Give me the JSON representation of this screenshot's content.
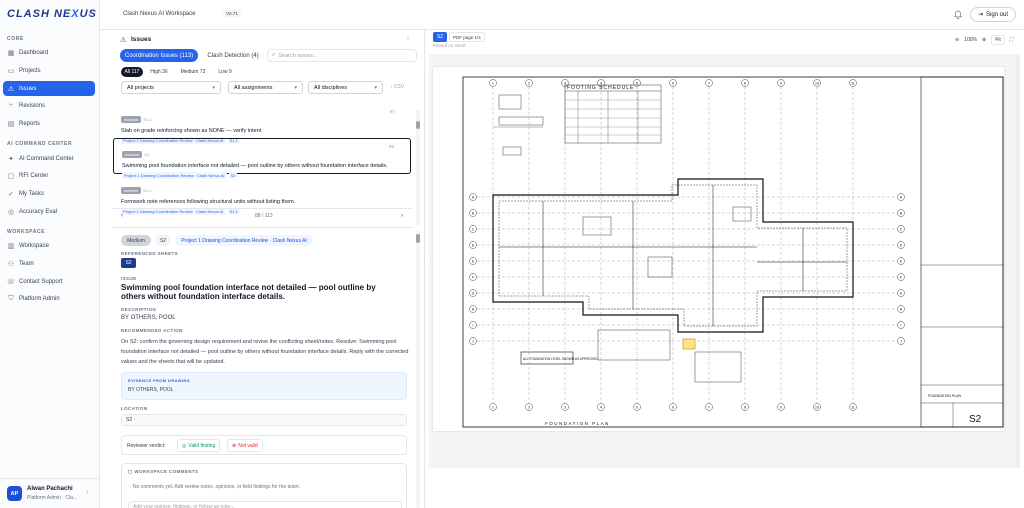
{
  "app": {
    "logo_left": "CLASH NE",
    "logo_accent": "X",
    "logo_right": "US",
    "workspace_name": "Clash Nexus AI Workspace",
    "version": "V0.71"
  },
  "topbar": {
    "signout_label": "Sign out"
  },
  "sidebar": {
    "sections": [
      {
        "title": "CORE",
        "items": [
          "Dashboard",
          "Projects",
          "Issues",
          "Revisions",
          "Reports"
        ]
      },
      {
        "title": "AI COMMAND CENTER",
        "items": [
          "AI Command Center",
          "RFI Center",
          "My Tasks",
          "Accuracy Eval"
        ]
      },
      {
        "title": "WORKSPACE",
        "items": [
          "Workspace",
          "Team",
          "Contact Support",
          "Platform Admin"
        ]
      }
    ],
    "active_item": "Issues"
  },
  "user": {
    "initials": "AP",
    "name": "Alwan Pachachi",
    "role": "Platform Admin · Cla..."
  },
  "issues": {
    "title": "Issues",
    "tabs": [
      "Coordination Issues (113)",
      "Clash Detection (4)"
    ],
    "search_placeholder": "Search issues...",
    "filter_chips": [
      "All 117",
      "High 36",
      "Medium 73",
      "Low 9"
    ],
    "selects": [
      "All projects",
      "All assignments",
      "All disciplines"
    ],
    "csv_label": "CSV",
    "list": [
      {
        "status": "medium",
        "id": "S1-1",
        "num": "87",
        "text": "Slab on grade reinforcing shown as NONE — verify intent",
        "tags": [
          "Project 1 Drawing Coordination Review · Clash Nexus AI",
          "S1.1"
        ]
      },
      {
        "status": "medium",
        "id": "S2",
        "num": "88",
        "text": "Swimming pool foundation interface not detailed — pool outline by others without foundation interface details.",
        "tags": [
          "Project 1 Drawing Coordination Review · Clash Nexus AI",
          "S2"
        ]
      },
      {
        "status": "medium",
        "id": "S1-1",
        "num": "",
        "text": "Formwork note references following structural units without listing them.",
        "tags": [
          "Project 1 Drawing Coordination Review · Clash Nexus AI",
          "S1.1"
        ]
      }
    ],
    "pager": "88 / 113"
  },
  "detail": {
    "chips": [
      "Medium",
      "S2",
      "Project 1 Drawing Coordination Review · Clash Nexus AI"
    ],
    "ref_sheets_label": "REFERENCED SHEETS",
    "ref_sheet": "S2",
    "issue_label": "ISSUE",
    "issue_title": "Swimming pool foundation interface not detailed — pool outline by others without foundation interface details.",
    "description_label": "DESCRIPTION",
    "description": "BY OTHERS, POOL",
    "action_label": "RECOMMENDED ACTION",
    "action": "On S2: confirm the governing design requirement and revise the conflicting sheet/notes. Resolve: Swimming pool foundation interface not detailed — pool outline by others without foundation interface details. Reply with the corrected values and the sheets that will be updated.",
    "evidence_label": "EVIDENCE FROM DRAWING",
    "evidence": "BY OTHERS, POOL",
    "location_label": "LOCATION",
    "location": "S2 ·",
    "verdict_label": "Reviewer verdict:",
    "valid_label": "Valid finding",
    "invalid_label": "Not valid",
    "comments_label": "WORKSPACE COMMENTS",
    "comments_empty": "No comments yet. Add review notes, opinions, or field findings for the team.",
    "comment_placeholder": "Add your opinion, findings, or follow-up note..."
  },
  "viewer": {
    "sheet_tab": "S2",
    "pdf_tab": "PDF page 1/4",
    "pinned_note": "Pinned on sheet",
    "zoom": "100%",
    "fit_label": "Fit",
    "drawing": {
      "schedule_title": "FOOTING SCHEDULE",
      "plan_title": "FOUNDATION PLAN",
      "callout": "ALL FOUNDATION LEVEL SHOWN AS APPROVED",
      "sheet_number": "S2",
      "sheet_name": "FOUNDATION PLAN",
      "grid_top": [
        "1",
        "2",
        "3",
        "4",
        "5",
        "6",
        "7",
        "8",
        "9",
        "10",
        "11"
      ],
      "grid_side": [
        "A",
        "B",
        "C",
        "D",
        "E",
        "F",
        "G",
        "H",
        "I",
        "J"
      ]
    }
  }
}
